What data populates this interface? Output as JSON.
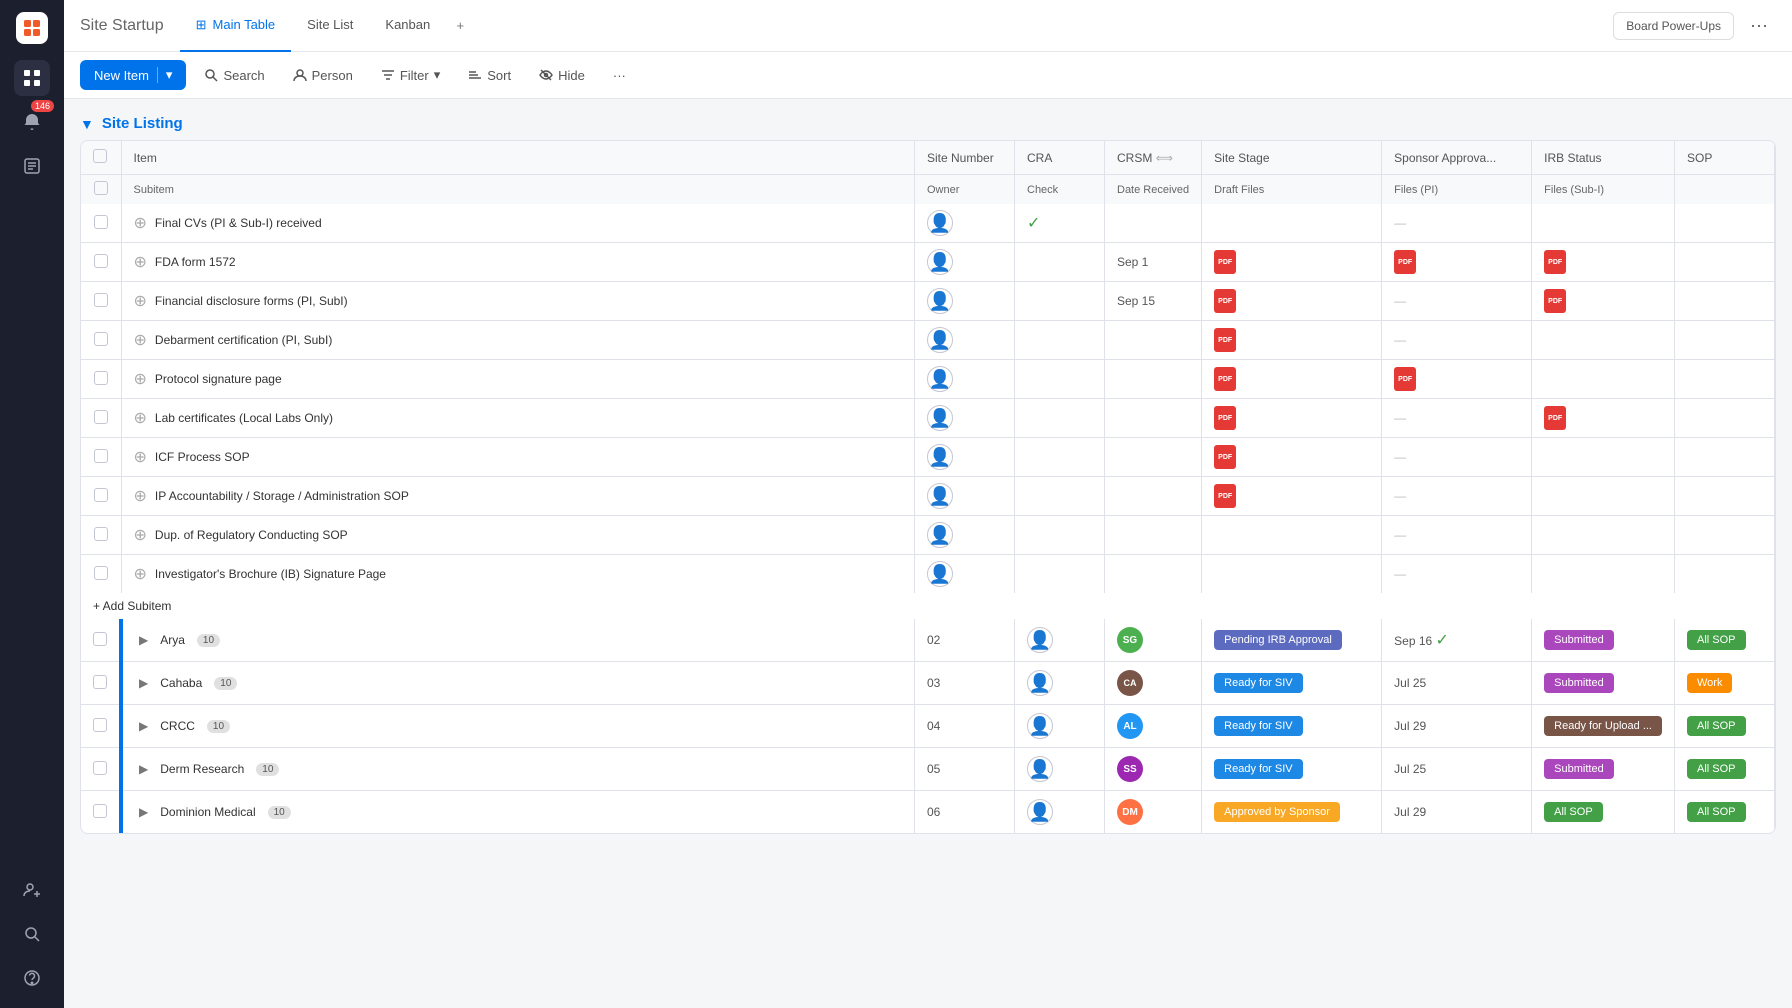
{
  "app": {
    "title": "Site Startup",
    "title_modified": "*"
  },
  "tabs": [
    {
      "id": "main-table",
      "label": "Main Table",
      "icon": "⊞",
      "active": true
    },
    {
      "id": "site-list",
      "label": "Site List",
      "icon": "",
      "active": false
    },
    {
      "id": "kanban",
      "label": "Kanban",
      "icon": "",
      "active": false
    }
  ],
  "toolbar": {
    "new_item": "New Item",
    "search": "Search",
    "person": "Person",
    "filter": "Filter",
    "sort": "Sort",
    "hide": "Hide",
    "more": "···",
    "board_power_ups": "Board Power-Ups"
  },
  "section": {
    "title": "Site Listing",
    "collapsed": false
  },
  "columns": {
    "item": "Item",
    "site_number": "Site Number",
    "cra": "CRA",
    "crsm": "CRSM",
    "site_stage": "Site Stage",
    "sponsor_approval": "Sponsor Approva...",
    "irb_status": "IRB Status",
    "sop": "SOP"
  },
  "subcolumns": {
    "subitem": "Subitem",
    "owner": "Owner",
    "check": "Check",
    "date_received": "Date Received",
    "draft_files": "Draft Files",
    "files_pi": "Files (PI)",
    "files_subi": "Files (Sub-I)"
  },
  "subitems": [
    {
      "name": "Final CVs (PI & Sub-I) received",
      "check": true,
      "date_received": "",
      "has_draft": false,
      "has_pi": false,
      "has_subi": false
    },
    {
      "name": "FDA form 1572",
      "check": false,
      "date_received": "Sep 1",
      "has_draft": true,
      "has_pi": true,
      "has_subi": true
    },
    {
      "name": "Financial disclosure forms (PI, SubI)",
      "check": false,
      "date_received": "Sep 15",
      "has_draft": true,
      "has_pi": false,
      "has_subi": true
    },
    {
      "name": "Debarment certification (PI, SubI)",
      "check": false,
      "date_received": "",
      "has_draft": true,
      "has_pi": false,
      "has_subi": false
    },
    {
      "name": "Protocol signature page",
      "check": false,
      "date_received": "",
      "has_draft": true,
      "has_pi": true,
      "has_subi": false
    },
    {
      "name": "Lab certificates (Local Labs Only)",
      "check": false,
      "date_received": "",
      "has_draft": true,
      "has_pi": false,
      "has_subi": true
    },
    {
      "name": "ICF Process SOP",
      "check": false,
      "date_received": "",
      "has_draft": true,
      "has_pi": false,
      "has_subi": false
    },
    {
      "name": "IP Accountability / Storage / Administration SOP",
      "check": false,
      "date_received": "",
      "has_draft": true,
      "has_pi": false,
      "has_subi": false
    },
    {
      "name": "Dup. of Regulatory Conducting SOP",
      "check": false,
      "date_received": "",
      "has_draft": false,
      "has_pi": false,
      "has_subi": false
    },
    {
      "name": "Investigator's Brochure (IB) Signature Page",
      "check": false,
      "date_received": "",
      "has_draft": false,
      "has_pi": false,
      "has_subi": false
    }
  ],
  "add_subitem": "+ Add Subitem",
  "sites": [
    {
      "name": "Arya",
      "count": 10,
      "site_number": "02",
      "crsm_avatar": "SG",
      "crsm_color": "#4caf50",
      "site_stage": "Pending IRB Approval",
      "site_stage_color": "#5c6bc0",
      "sponsor_date": "Sep 16",
      "sponsor_check": true,
      "irb_status": "Submitted",
      "irb_color": "#ab47bc",
      "sop": "All SOP",
      "sop_color": "#43a047"
    },
    {
      "name": "Cahaba",
      "count": 10,
      "site_number": "03",
      "crsm_avatar": "CA",
      "crsm_color": "#795548",
      "site_stage": "Ready for SIV",
      "site_stage_color": "#1e88e5",
      "sponsor_date": "Jul 25",
      "sponsor_check": false,
      "irb_status": "Submitted",
      "irb_color": "#ab47bc",
      "sop": "Work",
      "sop_color": "#fb8c00"
    },
    {
      "name": "CRCC",
      "count": 10,
      "site_number": "04",
      "crsm_avatar": "AL",
      "crsm_color": "#2196f3",
      "site_stage": "Ready for SIV",
      "site_stage_color": "#1e88e5",
      "sponsor_date": "Jul 29",
      "sponsor_check": false,
      "irb_status": "Ready for Upload ...",
      "irb_color": "#795548",
      "sop": "All SOP",
      "sop_color": "#43a047"
    },
    {
      "name": "Derm Research",
      "count": 10,
      "site_number": "05",
      "crsm_avatar": "SS",
      "crsm_color": "#9c27b0",
      "site_stage": "Ready for SIV",
      "site_stage_color": "#1e88e5",
      "sponsor_date": "Jul 25",
      "sponsor_check": false,
      "irb_status": "Submitted",
      "irb_color": "#ab47bc",
      "sop": "All SOP",
      "sop_color": "#43a047"
    },
    {
      "name": "Dominion Medical",
      "count": 10,
      "site_number": "06",
      "crsm_avatar": "DM",
      "crsm_color": "#ff7043",
      "site_stage": "Approved by Sponsor",
      "site_stage_color": "#f9a825",
      "sponsor_date": "Jul 29",
      "sponsor_check": false,
      "irb_status": "All SOP",
      "irb_color": "#43a047",
      "sop": "All SOP",
      "sop_color": "#43a047"
    }
  ],
  "notification_count": "146",
  "sidebar_icons": [
    "grid",
    "bell",
    "clipboard",
    "search",
    "help"
  ]
}
